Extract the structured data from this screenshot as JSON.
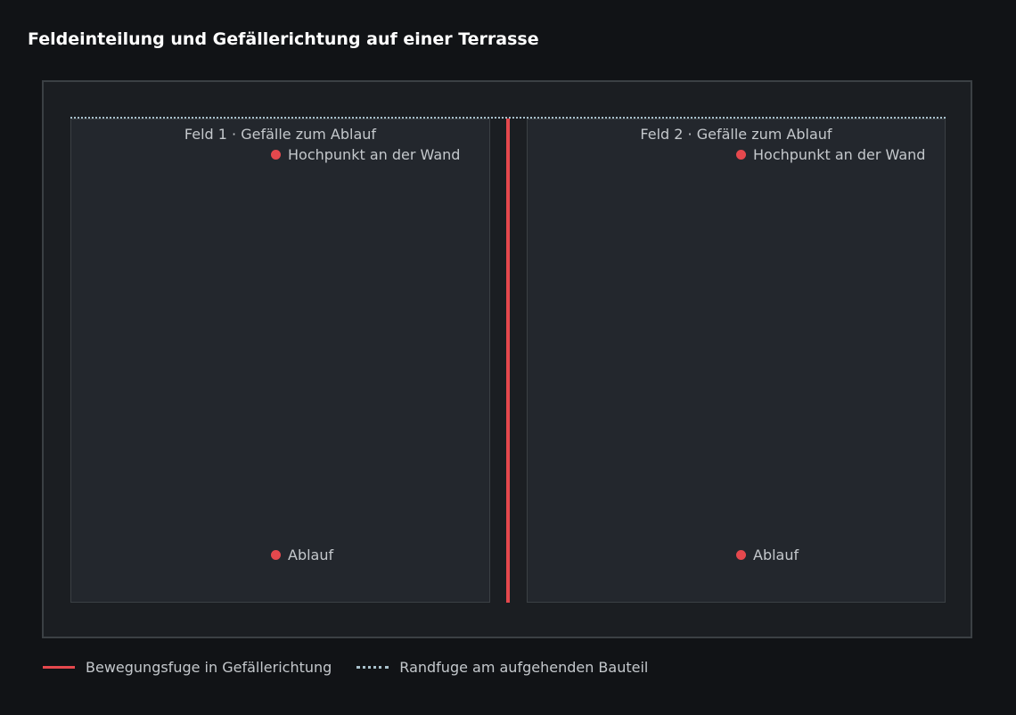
{
  "title": "Feldeinteilung und Gefällerichtung auf einer Terrasse",
  "fields": [
    {
      "label": "Feld 1 · Gefälle zum Ablauf",
      "high_point": "Hochpunkt an der Wand",
      "drain": "Ablauf"
    },
    {
      "label": "Feld 2 · Gefälle zum Ablauf",
      "high_point": "Hochpunkt an der Wand",
      "drain": "Ablauf"
    }
  ],
  "legend": {
    "movement_joint": "Bewegungsfuge in Gefällerichtung",
    "edge_joint": "Randfuge am aufgehenden Bauteil"
  },
  "colors": {
    "movement_joint": "#e5484d",
    "edge_joint": "#a9c1cc",
    "marker": "#e5484d",
    "background": "#111316"
  }
}
